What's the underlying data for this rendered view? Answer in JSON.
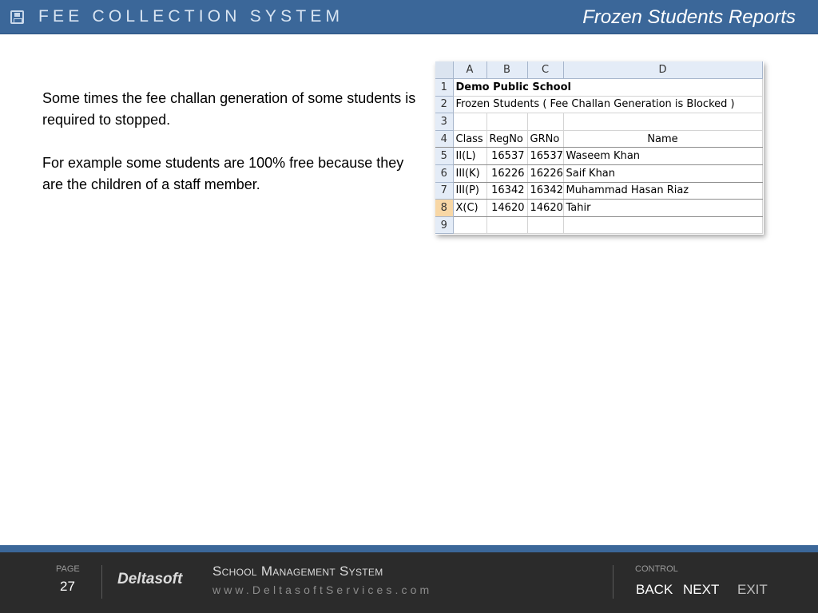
{
  "header": {
    "app_title": "FEE COLLECTION SYSTEM",
    "slide_title": "Frozen Students Reports"
  },
  "content": {
    "paragraph_1": "Some times the fee challan generation of some students is required to stopped.",
    "paragraph_2": "For example some students are 100% free because they are the children of  a staff member."
  },
  "spreadsheet": {
    "column_headers": [
      "A",
      "B",
      "C",
      "D"
    ],
    "row_numbers": [
      "1",
      "2",
      "3",
      "4",
      "5",
      "6",
      "7",
      "8",
      "9"
    ],
    "selected_row": "8",
    "school_name": "Demo Public School",
    "report_title": "Frozen Students ( Fee Challan Generation is Blocked )",
    "table_headers": [
      "Class",
      "RegNo",
      "GRNo",
      "Name"
    ],
    "rows": [
      {
        "class": "II(L)",
        "regno": "16537",
        "grno": "16537",
        "name": "Waseem Khan"
      },
      {
        "class": "III(K)",
        "regno": "16226",
        "grno": "16226",
        "name": "Saif Khan"
      },
      {
        "class": "III(P)",
        "regno": "16342",
        "grno": "16342",
        "name": "Muhammad Hasan Riaz"
      },
      {
        "class": "X(C)",
        "regno": "14620",
        "grno": "14620",
        "name": "Tahir"
      }
    ]
  },
  "footer": {
    "page_label": "PAGE",
    "page_number": "27",
    "brand": "Deltasoft",
    "system_name": "School Management System",
    "website": "www.DeltasoftServices.com",
    "control_label": "CONTROL",
    "back_label": "BACK",
    "next_label": "NEXT",
    "exit_label": "EXIT"
  },
  "colors": {
    "header_bg": "#3b6799",
    "footer_bg": "#2b2b2b",
    "selected_row_header": "#f8d7a5"
  }
}
